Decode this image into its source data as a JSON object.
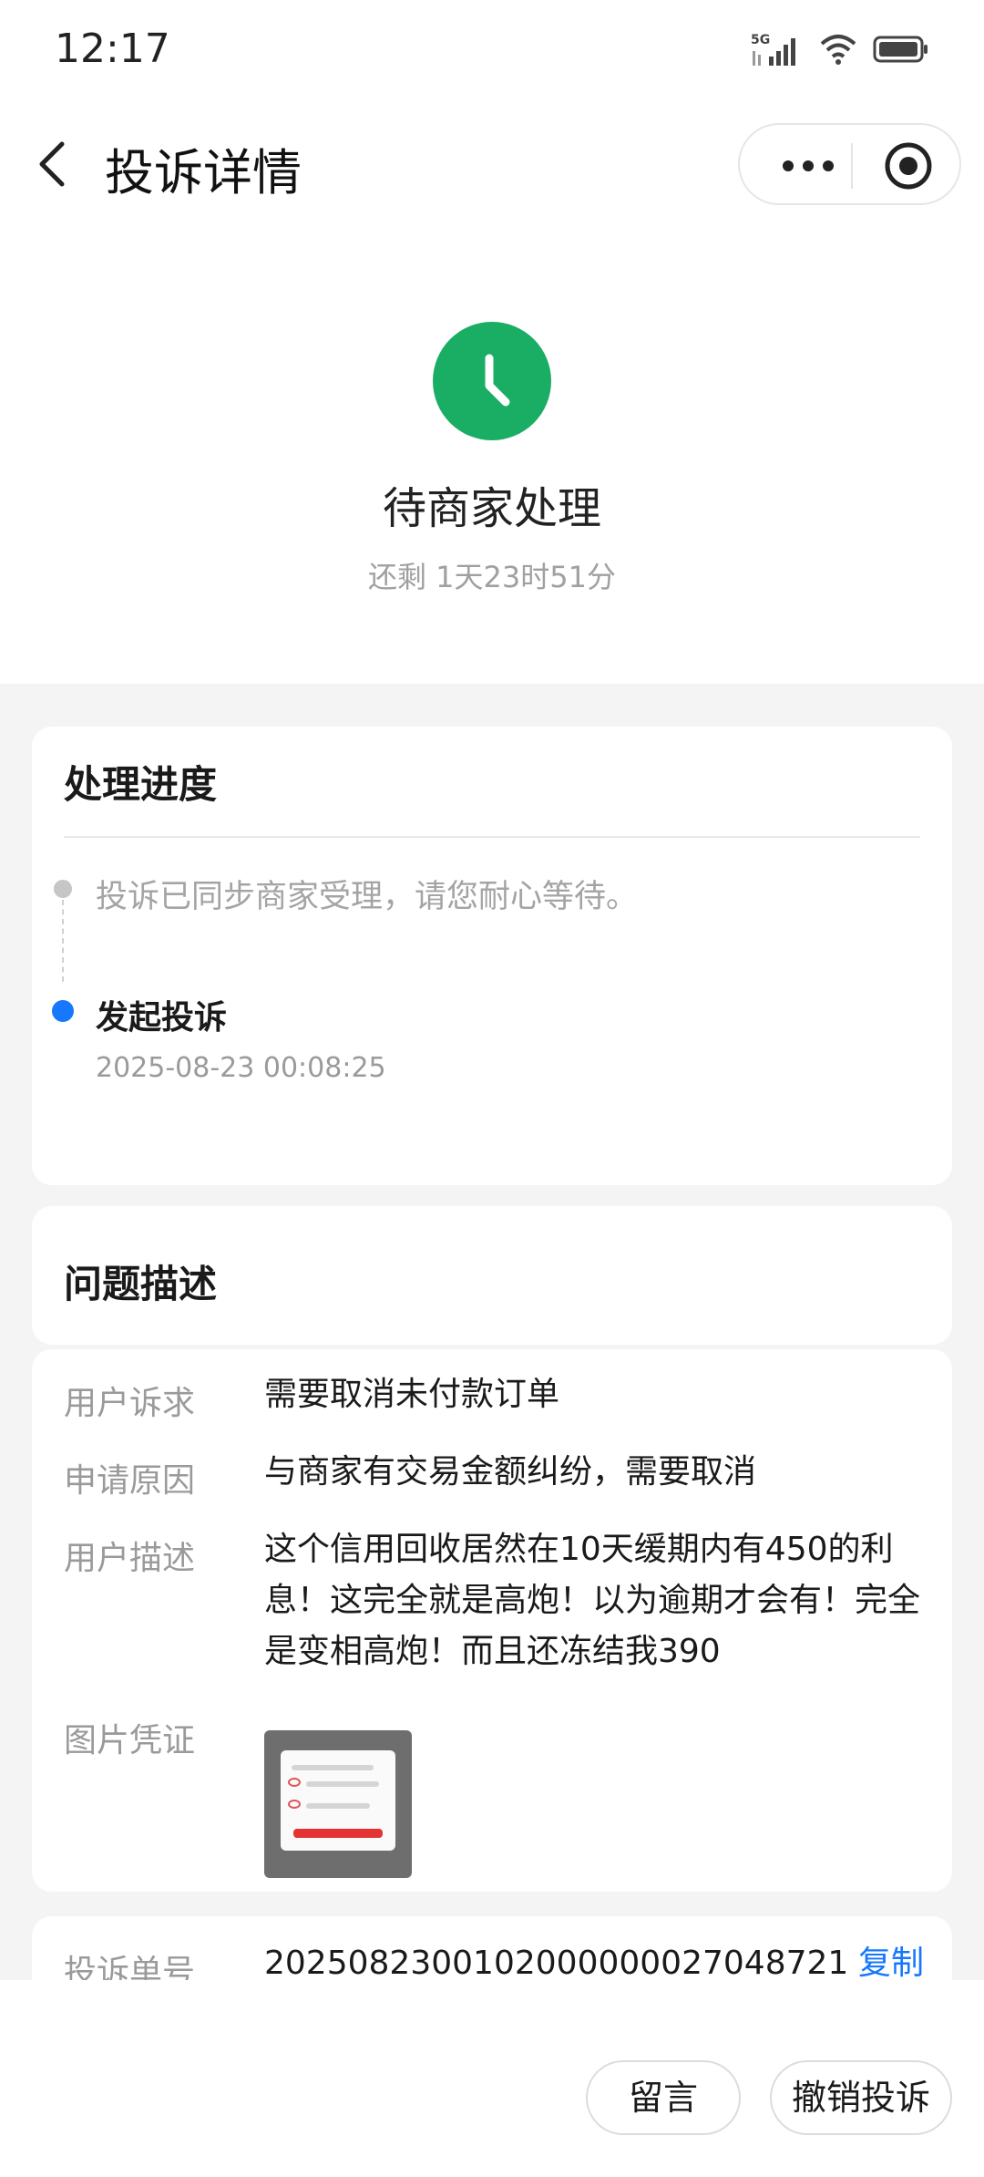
{
  "status_bar": {
    "time": "12:17",
    "network": "5G",
    "icons": [
      "signal-icon",
      "wifi-icon",
      "battery-icon"
    ]
  },
  "nav": {
    "title": "投诉详情",
    "icons": [
      "back-arrow-icon",
      "more-dots-icon",
      "target-icon"
    ]
  },
  "status": {
    "title": "待商家处理",
    "remaining": "还剩 1天23时51分",
    "color": "#1aad64",
    "icon": "clock-icon"
  },
  "progress": {
    "title": "处理进度",
    "items": [
      {
        "text": "投诉已同步商家受理，请您耐心等待。"
      },
      {
        "title": "发起投诉",
        "time": "2025-08-23 00:08:25"
      }
    ],
    "active_color": "#1677ff"
  },
  "description": {
    "title": "问题描述",
    "rows": [
      {
        "label": "用户诉求",
        "value": "需要取消未付款订单"
      },
      {
        "label": "申请原因",
        "value": "与商家有交易金额纠纷，需要取消"
      },
      {
        "label": "用户描述",
        "value": "这个信用回收居然在10天缓期内有450的利息！这完全就是高炮！以为逾期才会有！完全是变相高炮！而且还冻结我390"
      },
      {
        "label": "图片凭证"
      }
    ]
  },
  "order": {
    "label": "投诉单号",
    "number": "2025082300102000000027048721",
    "copy_label": "复制",
    "link_color": "#1677ff"
  },
  "actions": {
    "message_label": "留言",
    "revoke_label": "撤销投诉"
  }
}
